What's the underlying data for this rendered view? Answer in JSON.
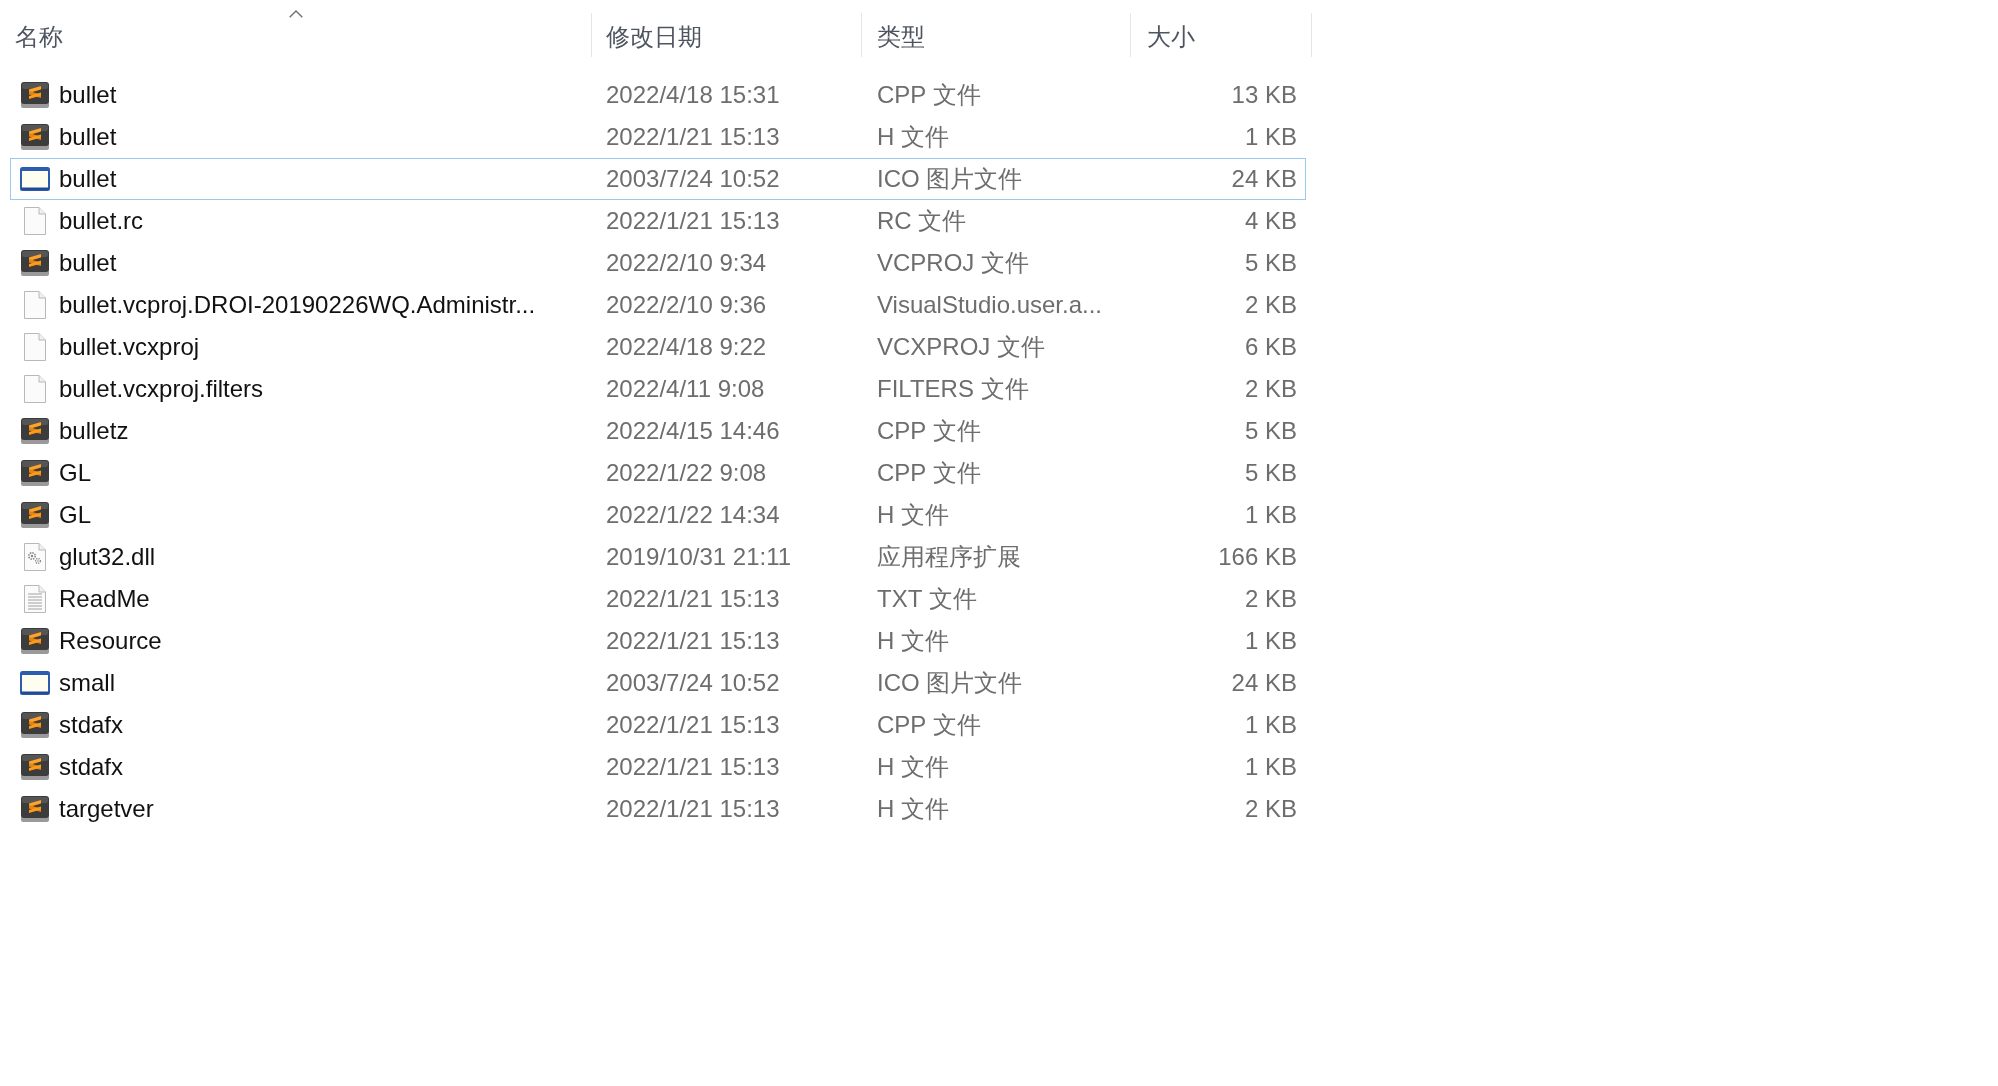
{
  "columns": [
    {
      "label": "名称",
      "sorted": true
    },
    {
      "label": "修改日期",
      "sorted": false
    },
    {
      "label": "类型",
      "sorted": false
    },
    {
      "label": "大小",
      "sorted": false
    }
  ],
  "rows": [
    {
      "kind": "source",
      "name": "bullet",
      "modified": "2022/4/18 15:31",
      "type": "CPP 文件",
      "size": "13 KB",
      "selected": false
    },
    {
      "kind": "source",
      "name": "bullet",
      "modified": "2022/1/21 15:13",
      "type": "H 文件",
      "size": "1 KB",
      "selected": false
    },
    {
      "kind": "image",
      "name": "bullet",
      "modified": "2003/7/24 10:52",
      "type": "ICO 图片文件",
      "size": "24 KB",
      "selected": true
    },
    {
      "kind": "blank",
      "name": "bullet.rc",
      "modified": "2022/1/21 15:13",
      "type": "RC 文件",
      "size": "4 KB",
      "selected": false
    },
    {
      "kind": "source",
      "name": "bullet",
      "modified": "2022/2/10 9:34",
      "type": "VCPROJ 文件",
      "size": "5 KB",
      "selected": false
    },
    {
      "kind": "blank",
      "name": "bullet.vcproj.DROI-20190226WQ.Administr...",
      "modified": "2022/2/10 9:36",
      "type": "VisualStudio.user.a...",
      "size": "2 KB",
      "selected": false
    },
    {
      "kind": "blank",
      "name": "bullet.vcxproj",
      "modified": "2022/4/18 9:22",
      "type": "VCXPROJ 文件",
      "size": "6 KB",
      "selected": false
    },
    {
      "kind": "blank",
      "name": "bullet.vcxproj.filters",
      "modified": "2022/4/11 9:08",
      "type": "FILTERS 文件",
      "size": "2 KB",
      "selected": false
    },
    {
      "kind": "source",
      "name": "bulletz",
      "modified": "2022/4/15 14:46",
      "type": "CPP 文件",
      "size": "5 KB",
      "selected": false
    },
    {
      "kind": "source",
      "name": "GL",
      "modified": "2022/1/22 9:08",
      "type": "CPP 文件",
      "size": "5 KB",
      "selected": false
    },
    {
      "kind": "source",
      "name": "GL",
      "modified": "2022/1/22 14:34",
      "type": "H 文件",
      "size": "1 KB",
      "selected": false
    },
    {
      "kind": "library",
      "name": "glut32.dll",
      "modified": "2019/10/31 21:11",
      "type": "应用程序扩展",
      "size": "166 KB",
      "selected": false
    },
    {
      "kind": "text",
      "name": "ReadMe",
      "modified": "2022/1/21 15:13",
      "type": "TXT 文件",
      "size": "2 KB",
      "selected": false
    },
    {
      "kind": "source",
      "name": "Resource",
      "modified": "2022/1/21 15:13",
      "type": "H 文件",
      "size": "1 KB",
      "selected": false
    },
    {
      "kind": "image",
      "name": "small",
      "modified": "2003/7/24 10:52",
      "type": "ICO 图片文件",
      "size": "24 KB",
      "selected": false
    },
    {
      "kind": "source",
      "name": "stdafx",
      "modified": "2022/1/21 15:13",
      "type": "CPP 文件",
      "size": "1 KB",
      "selected": false
    },
    {
      "kind": "source",
      "name": "stdafx",
      "modified": "2022/1/21 15:13",
      "type": "H 文件",
      "size": "1 KB",
      "selected": false
    },
    {
      "kind": "source",
      "name": "targetver",
      "modified": "2022/1/21 15:13",
      "type": "H 文件",
      "size": "2 KB",
      "selected": false
    }
  ]
}
